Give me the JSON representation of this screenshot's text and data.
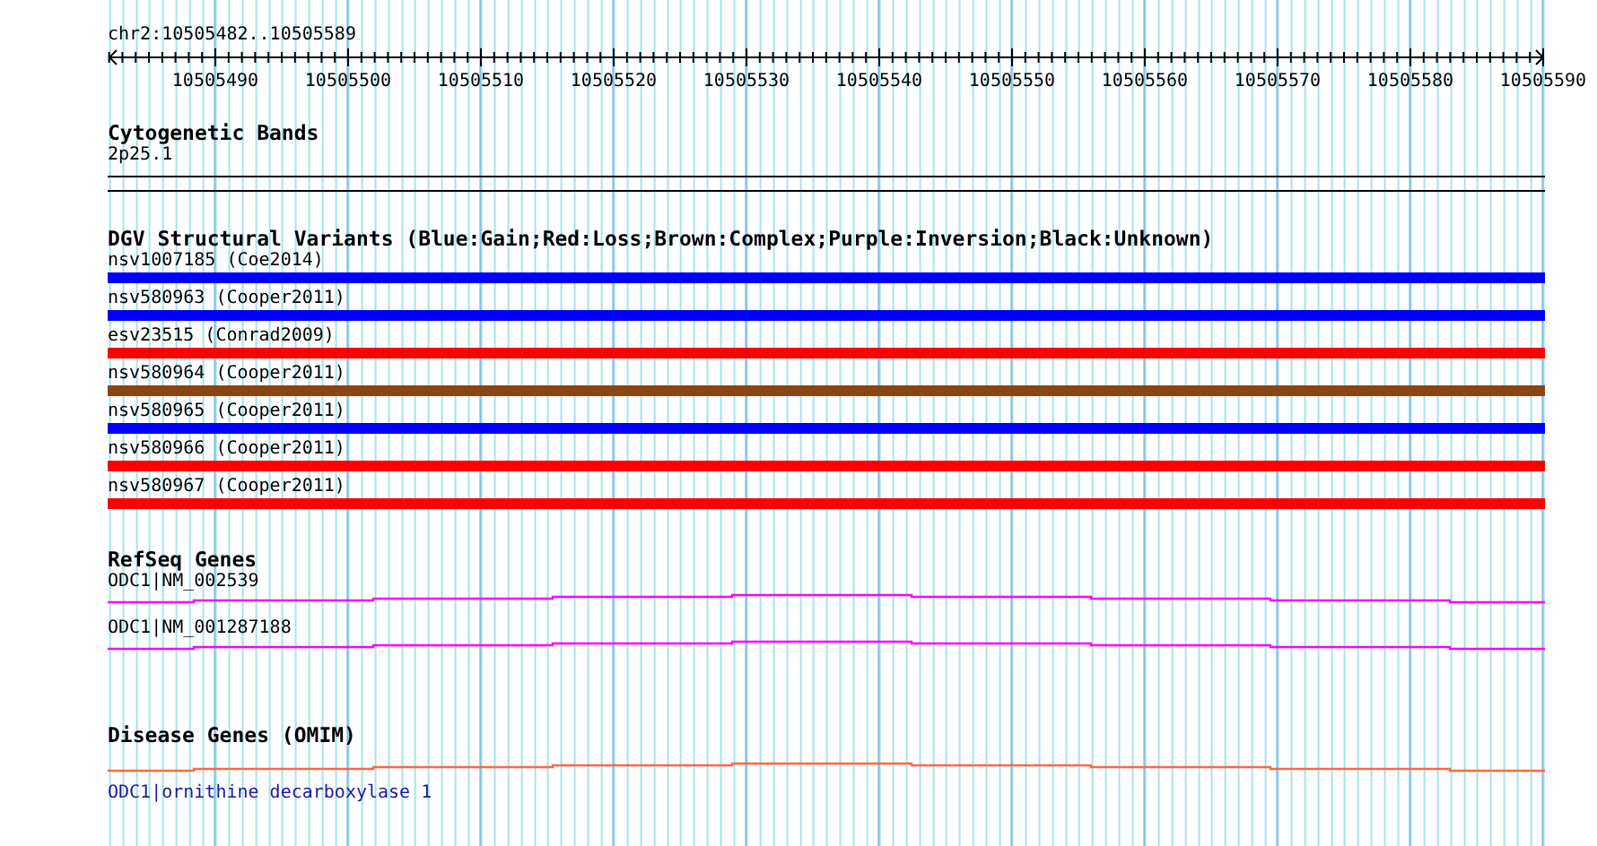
{
  "position": "chr2:10505482..10505589",
  "ruler": {
    "labels": [
      "10505490",
      "10505500",
      "10505510",
      "10505520",
      "10505530",
      "10505540",
      "10505550",
      "10505560",
      "10505570",
      "10505580",
      "10505590"
    ]
  },
  "cytogenetic_bands": {
    "title": "Cytogenetic Bands",
    "band": "2p25.1"
  },
  "dgv": {
    "title": "DGV Structural Variants (Blue:Gain;Red:Loss;Brown:Complex;Purple:Inversion;Black:Unknown)",
    "variants": [
      {
        "label": "nsv1007185 (Coe2014)",
        "color": "#0000ff"
      },
      {
        "label": "nsv580963 (Cooper2011)",
        "color": "#0000ff"
      },
      {
        "label": "esv23515 (Conrad2009)",
        "color": "#ff0000"
      },
      {
        "label": "nsv580964 (Cooper2011)",
        "color": "#8b4513"
      },
      {
        "label": "nsv580965 (Cooper2011)",
        "color": "#0000ff"
      },
      {
        "label": "nsv580966 (Cooper2011)",
        "color": "#ff0000"
      },
      {
        "label": "nsv580967 (Cooper2011)",
        "color": "#ff0000"
      }
    ]
  },
  "refseq": {
    "title": "RefSeq Genes",
    "genes": [
      {
        "label": "ODC1|NM_002539"
      },
      {
        "label": "ODC1|NM_001287188"
      }
    ]
  },
  "omim": {
    "title": "Disease Genes (OMIM)",
    "gene": "ODC1|ornithine decarboxylase 1"
  }
}
